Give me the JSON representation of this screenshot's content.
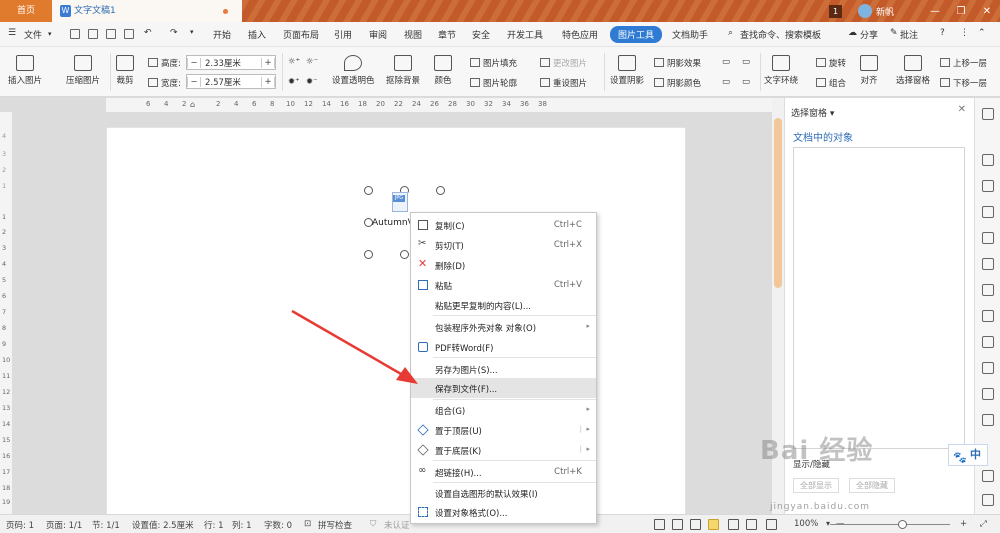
{
  "titlebar": {
    "home_tab": "首页",
    "doc_tab": "文字文稿1",
    "badge": "1",
    "user": "新帆",
    "win_buttons": [
      "—",
      "❐",
      "✕"
    ]
  },
  "menubar": {
    "file": "文件",
    "items": [
      "开始",
      "插入",
      "页面布局",
      "引用",
      "审阅",
      "视图",
      "章节",
      "安全",
      "开发工具",
      "特色应用",
      "图片工具",
      "文档助手"
    ],
    "active": "图片工具",
    "search": "查找命令、搜索模板",
    "share": "分享",
    "comment": "批注",
    "help": "?"
  },
  "ribbon": {
    "insert_picture": "插入图片",
    "compress_picture": "压缩图片",
    "crop": "裁剪",
    "height_label": "高度:",
    "height_value": "2.33厘米",
    "width_label": "宽度:",
    "width_value": "2.57厘米",
    "transparent": "设置透明色",
    "remove_bg": "抠除背景",
    "color": "颜色",
    "picture_fill": "图片填充",
    "picture_outline": "图片轮廓",
    "change_picture": "更改图片",
    "reset_picture": "重设图片",
    "set_shadow": "设置阴影",
    "shadow_effect": "阴影效果",
    "shadow_color": "阴影颜色",
    "text_wrap": "文字环绕",
    "rotate": "旋转",
    "group": "组合",
    "align": "对齐",
    "selection_pane": "选择窗格",
    "bring_forward": "上移一层",
    "send_backward": "下移一层"
  },
  "ruler": {
    "h_labels": [
      "6",
      "4",
      "2",
      "2",
      "4",
      "6",
      "8",
      "10",
      "12",
      "14",
      "16",
      "18",
      "20",
      "22",
      "24",
      "26",
      "28",
      "30",
      "32",
      "34",
      "36",
      "38"
    ],
    "v_labels_neg": [
      "4",
      "3",
      "2",
      "1"
    ],
    "v_labels": [
      "1",
      "2",
      "3",
      "4",
      "5",
      "6",
      "7",
      "8",
      "9",
      "10",
      "11",
      "12",
      "13",
      "14",
      "15",
      "16",
      "17",
      "18",
      "19",
      "20"
    ]
  },
  "document": {
    "picture_tag": "JPG",
    "picture_caption": "AutumnV"
  },
  "context_menu": {
    "items": [
      {
        "label": "复制(C)",
        "shortcut": "Ctrl+C",
        "icon": "copy-icon"
      },
      {
        "label": "剪切(T)",
        "shortcut": "Ctrl+X",
        "icon": "scissors-icon"
      },
      {
        "label": "删除(D)",
        "shortcut": "",
        "icon": "delete-x-icon"
      },
      {
        "label": "粘贴",
        "shortcut": "Ctrl+V",
        "icon": "paste-icon"
      },
      {
        "label": "粘贴更早复制的内容(L)...",
        "shortcut": "",
        "icon": ""
      },
      {
        "label": "包装程序外壳对象 对象(O)",
        "shortcut": "",
        "icon": "",
        "submenu": true
      },
      {
        "label": "PDF转Word(F)",
        "shortcut": "",
        "icon": "pdf-icon"
      },
      {
        "label": "另存为图片(S)...",
        "shortcut": "",
        "icon": ""
      },
      {
        "label": "保存到文件(F)...",
        "shortcut": "",
        "icon": "",
        "highlighted": true
      },
      {
        "label": "组合(G)",
        "shortcut": "",
        "icon": "",
        "submenu": true
      },
      {
        "label": "置于顶层(U)",
        "shortcut": "",
        "icon": "layers-up-icon",
        "submenu": true
      },
      {
        "label": "置于底层(K)",
        "shortcut": "",
        "icon": "layers-down-icon",
        "submenu": true
      },
      {
        "label": "超链接(H)...",
        "shortcut": "Ctrl+K",
        "icon": "link-icon"
      },
      {
        "label": "设置自选图形的默认效果(I)",
        "shortcut": "",
        "icon": ""
      },
      {
        "label": "设置对象格式(O)...",
        "shortcut": "",
        "icon": "format-icon"
      }
    ],
    "submenu_arrow": "▸"
  },
  "selection_pane": {
    "title": "选择窗格",
    "subtitle": "文档中的对象",
    "footer": "显示/隐藏",
    "show_all": "全部显示",
    "hide_all": "全部隐藏"
  },
  "statusbar": {
    "page_num": "页码: 1",
    "pages": "页面: 1/1",
    "section": "节: 1/1",
    "setting": "设置值: 2.5厘米",
    "row": "行: 1",
    "col": "列: 1",
    "words": "字数: 0",
    "spell": "拼写检查",
    "cert": "未认证",
    "zoom": "100%",
    "minus": "—",
    "plus": "+"
  },
  "watermark": {
    "logo": "Bai 经验",
    "url": "jingyan.baidu.com"
  },
  "ime": {
    "label": "中"
  },
  "colors": {
    "accent": "#2f7bd3",
    "titlebar": "#c25a2a",
    "arrow": "#e83a35"
  }
}
